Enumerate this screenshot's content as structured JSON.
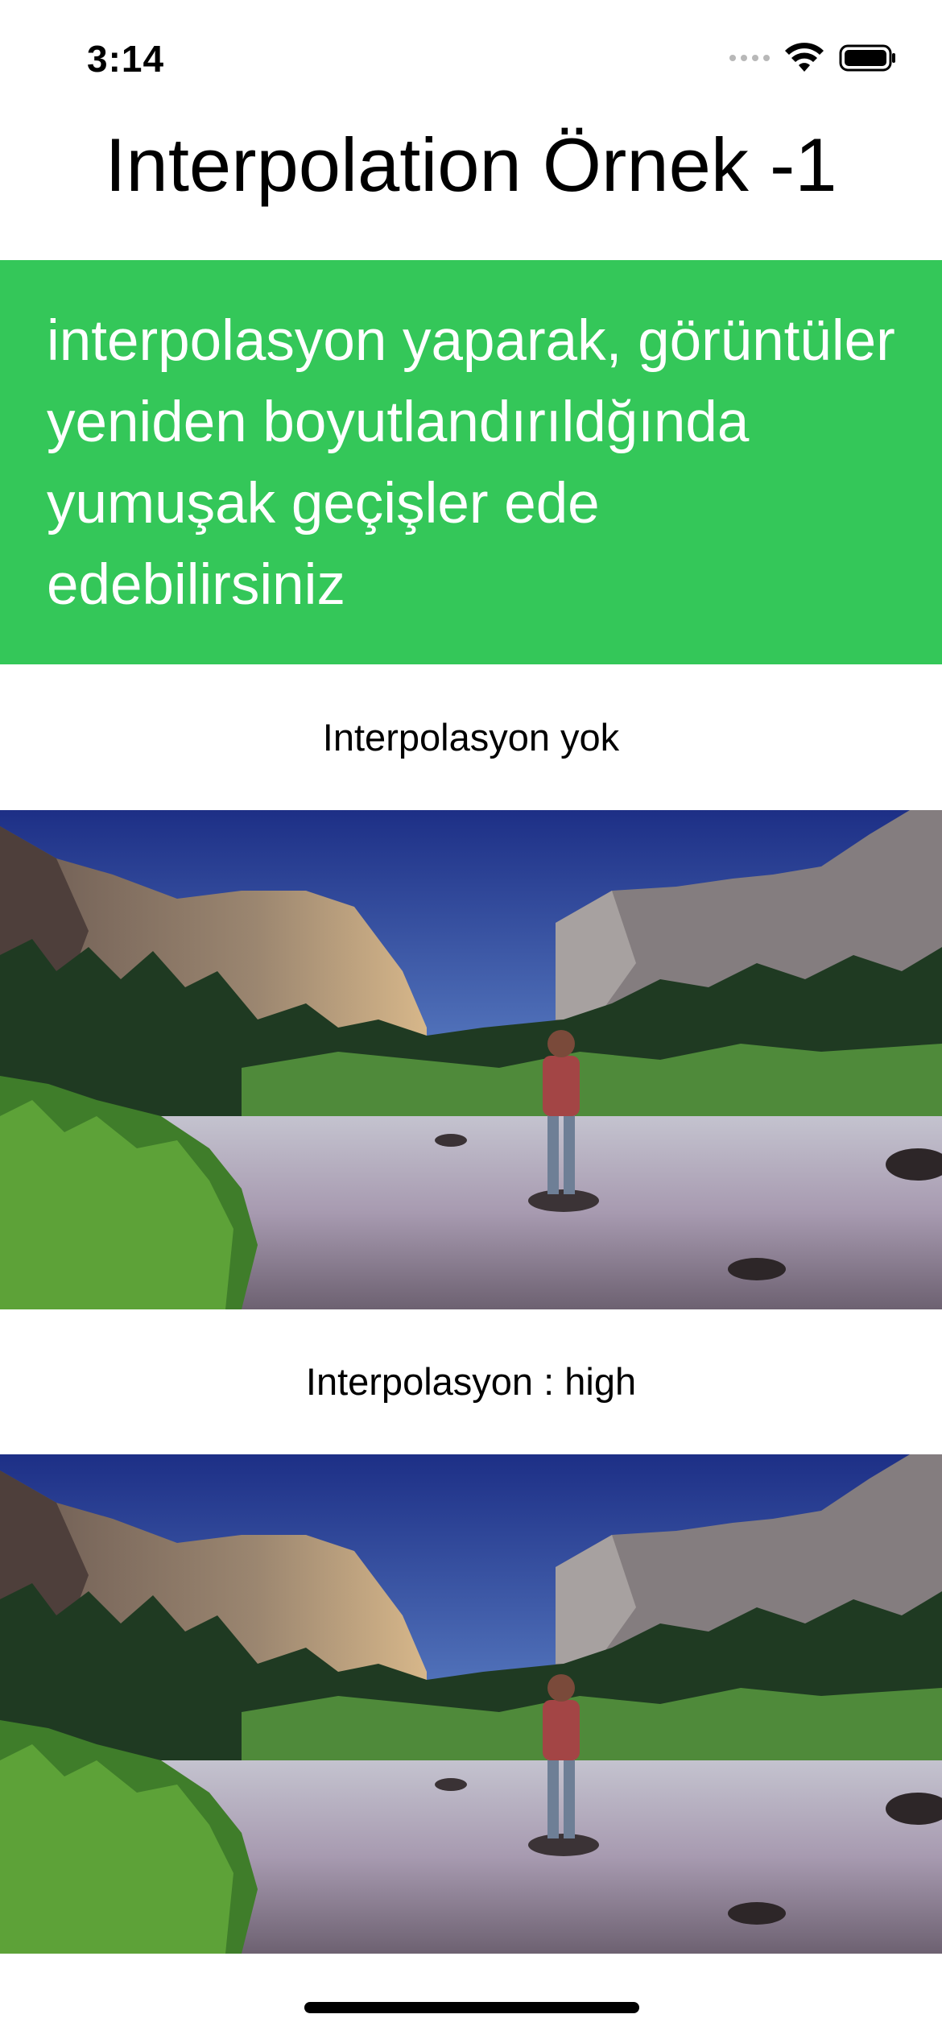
{
  "status_bar": {
    "time": "3:14",
    "icons": [
      "cellular-signal-icon",
      "wifi-icon",
      "battery-icon"
    ]
  },
  "header": {
    "title": "Interpolation Örnek -1"
  },
  "banner": {
    "text": "interpolasyon yaparak, görüntüler yeniden boyutlandırıldğında yumuşak geçişler ede edebilirsiniz",
    "background_color": "#34c759",
    "text_color": "#ffffff"
  },
  "sections": [
    {
      "label": "Interpolasyon yok",
      "image": "landscape-river-mountains"
    },
    {
      "label": "Interpolasyon : high",
      "image": "landscape-river-mountains"
    }
  ]
}
